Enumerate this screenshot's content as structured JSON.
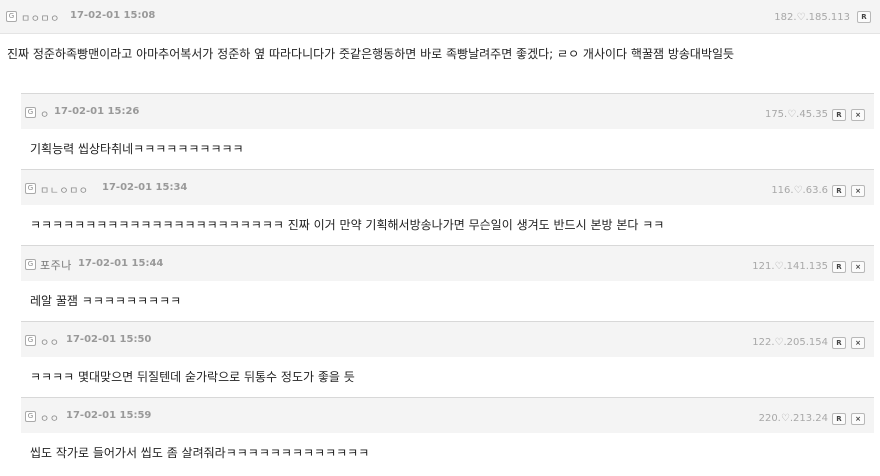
{
  "main_comment": {
    "nickname": "ㅁㅇㅁㅇ",
    "date": "17-02-01 15:08",
    "ip": "182.♡.185.113",
    "reply_button": "R",
    "body": "진짜 정준하족빵맨이라고 아마추어복서가 정준하 옆 따라다니다가 줏같은행동하면 바로 족빵날려주면 좋겠다; ㄹㅇ 개사이다 핵꿀잼 방송대박일듯"
  },
  "icon_letter": "G",
  "delete_button": "×",
  "replies": [
    {
      "nickname": "ㅇ",
      "date": "17-02-01 15:26",
      "ip": "175.♡.45.35",
      "reply_button": "R",
      "body": "기획능력 씹상타취네ㅋㅋㅋㅋㅋㅋㅋㅋㅋㅋ"
    },
    {
      "nickname": "ㅁㄴㅇㅁㅇ",
      "date": "17-02-01 15:34",
      "ip": "116.♡.63.6",
      "reply_button": "R",
      "body": "ㅋㅋㅋㅋㅋㅋㅋㅋㅋㅋㅋㅋㅋㅋㅋㅋㅋㅋㅋㅋㅋㅋㅋ 진짜 이거 만약 기획해서방송나가면 무슨일이 생겨도 반드시 본방 본다 ㅋㅋ"
    },
    {
      "nickname": "포주나",
      "date": "17-02-01 15:44",
      "ip": "121.♡.141.135",
      "reply_button": "R",
      "body": "레알 꿀잼 ㅋㅋㅋㅋㅋㅋㅋㅋㅋ"
    },
    {
      "nickname": "ㅇㅇ",
      "date": "17-02-01 15:50",
      "ip": "122.♡.205.154",
      "reply_button": "R",
      "body": "ㅋㅋㅋㅋ 몇대맞으면 뒤질텐데 숟가락으로 뒤통수 정도가 좋을 듯"
    },
    {
      "nickname": "ㅇㅇ",
      "date": "17-02-01 15:59",
      "ip": "220.♡.213.24",
      "reply_button": "R",
      "body": "씹도 작가로 들어가서 씹도 좀 살려줘라ㅋㅋㅋㅋㅋㅋㅋㅋㅋㅋㅋㅋㅋ"
    }
  ]
}
